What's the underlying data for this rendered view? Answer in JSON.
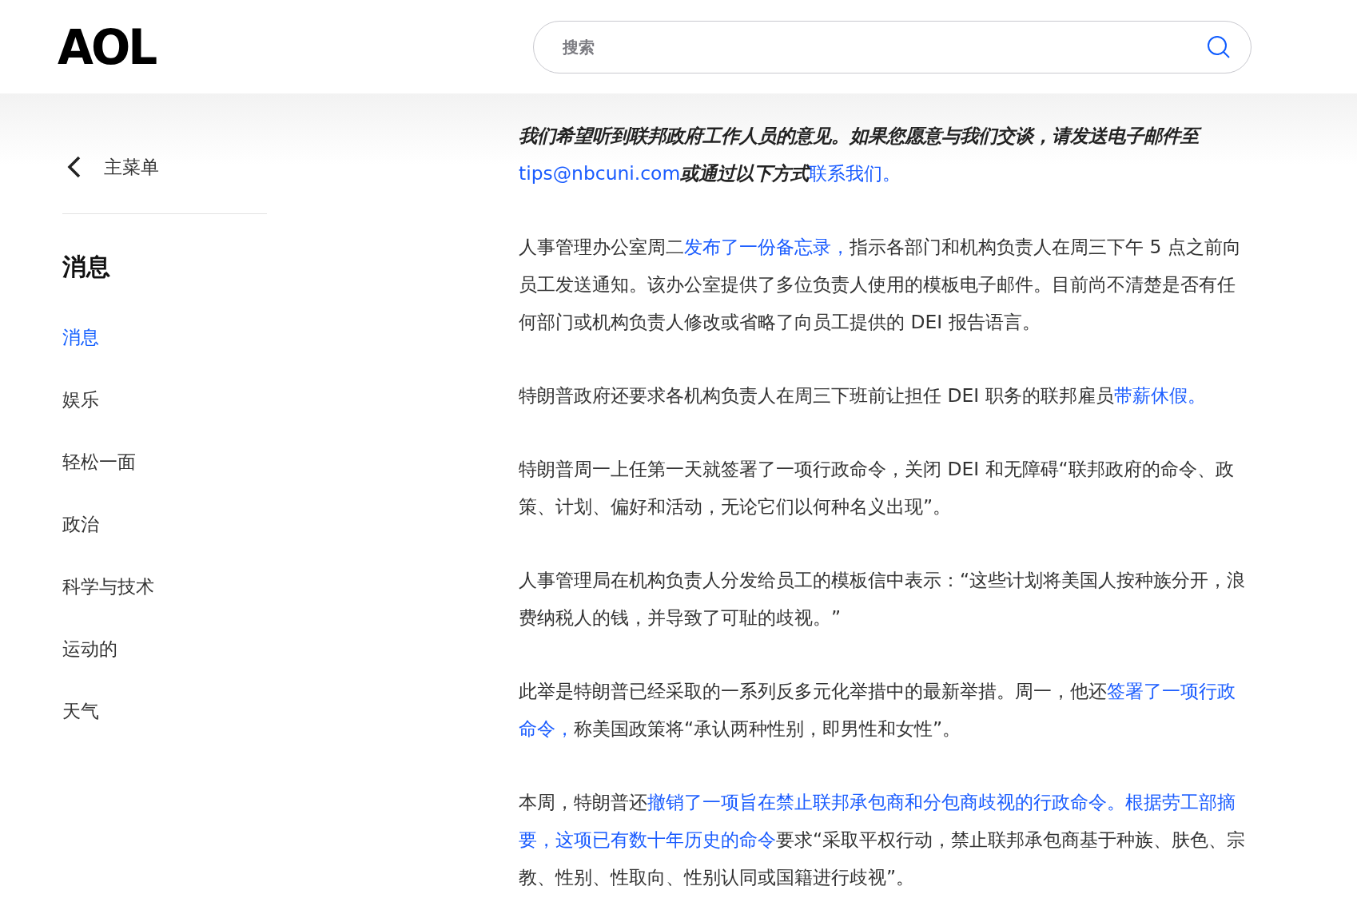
{
  "header": {
    "logo": "AOL",
    "search": {
      "placeholder": "搜索"
    }
  },
  "sidebar": {
    "back_label": "主菜单",
    "heading": "消息",
    "items": [
      {
        "label": "消息",
        "selected": true
      },
      {
        "label": "娱乐",
        "selected": false
      },
      {
        "label": "轻松一面",
        "selected": false
      },
      {
        "label": "政治",
        "selected": false
      },
      {
        "label": "科学与技术",
        "selected": false
      },
      {
        "label": "运动的",
        "selected": false
      },
      {
        "label": "天气",
        "selected": false
      }
    ]
  },
  "article": {
    "paragraphs": [
      [
        {
          "kind": "emphasis",
          "text": "我们希望听到联邦政府工作人员的意见。如果您愿意与我们交谈，请发送电子邮件至"
        },
        {
          "kind": "link",
          "text": "tips@nbcuni.com"
        },
        {
          "kind": "emphasis",
          "text": "或通过以下方式"
        },
        {
          "kind": "link",
          "text": "联系我们。"
        }
      ],
      [
        {
          "kind": "text",
          "text": "人事管理办公室周二"
        },
        {
          "kind": "link",
          "text": "发布了一份备忘录，"
        },
        {
          "kind": "text",
          "text": "指示各部门和机构负责人在周三下午 5 点之前向员工发送通知。该办公室提供了多位负责人使用的模板电子邮件。目前尚不清楚是否有任何部门或机构负责人修改或省略了向员工提供的 DEI 报告语言。"
        }
      ],
      [
        {
          "kind": "text",
          "text": "特朗普政府还要求各机构负责人在周三下班前让担任 DEI 职务的联邦雇员"
        },
        {
          "kind": "link",
          "text": "带薪休假。"
        }
      ],
      [
        {
          "kind": "text",
          "text": "特朗普周一上任第一天就签署了一项行政命令，关闭 DEI 和无障碍“联邦政府的命令、政策、计划、偏好和活动，无论它们以何种名义出现”。"
        }
      ],
      [
        {
          "kind": "text",
          "text": "人事管理局在机构负责人分发给员工的模板信中表示：“这些计划将美国人按种族分开，浪费纳税人的钱，并导致了可耻的歧视。”"
        }
      ],
      [
        {
          "kind": "text",
          "text": "此举是特朗普已经采取的一系列反多元化举措中的最新举措。周一，他还"
        },
        {
          "kind": "link",
          "text": "签署了一项行政"
        },
        {
          "kind": "link",
          "text": "命令，"
        },
        {
          "kind": "text",
          "text": "称美国政策将“承认两种性别，即男性和女性”。"
        }
      ],
      [
        {
          "kind": "text",
          "text": "本周，特朗普还"
        },
        {
          "kind": "link",
          "text": "撤销了一项旨在禁止联邦承包商和分包商歧视的行政命令。根据劳工部摘"
        },
        {
          "kind": "link",
          "text": "要，这项已有数十年历史的命令"
        },
        {
          "kind": "text",
          "text": "要求“采取平权行动，禁止联邦承包商基于种族、肤色、宗教、性别、性取向、性别认同或国籍进行歧视”。"
        }
      ]
    ]
  }
}
